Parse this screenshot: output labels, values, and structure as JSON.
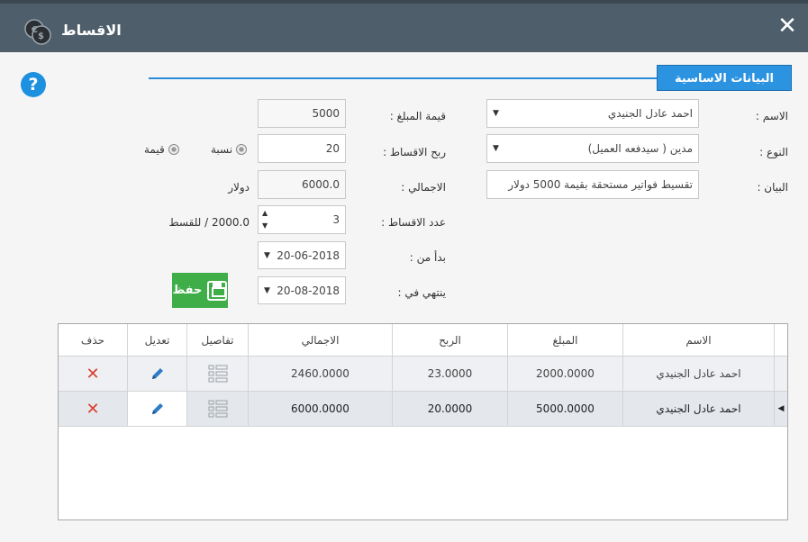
{
  "window": {
    "title": "الاقساط",
    "close_icon": "close-icon",
    "logo_icon": "coins-icon"
  },
  "help": {
    "label": "?"
  },
  "section": {
    "tab_label": "البيانات الاساسية"
  },
  "form": {
    "name": {
      "label": "الاسم :",
      "value": "احمد عادل الجنيدي"
    },
    "type": {
      "label": "النوع :",
      "value": "مدين ( سيدفعه العميل)"
    },
    "statement": {
      "label": "البيان :",
      "value": "تقسيط فواتير مستحقة بقيمة 5000 دولار"
    },
    "amount": {
      "label": "قيمة المبلغ :",
      "value": "5000"
    },
    "profit": {
      "label": "ربح الاقساط :",
      "value": "20"
    },
    "radio_percent": "نسبة",
    "radio_value": "قيمة",
    "total": {
      "label": "الاجمالي :",
      "value": "6000.0",
      "currency": "دولار"
    },
    "installments": {
      "label": "عدد الاقساط :",
      "value": "3",
      "per_installment": "2000.0 / للقسط"
    },
    "start": {
      "label": "بدأ من :",
      "value": "20-06-2018"
    },
    "end": {
      "label": "ينتهي في :",
      "value": "20-08-2018"
    },
    "save_label": "حفظ"
  },
  "grid": {
    "columns": [
      "الاسم",
      "المبلغ",
      "الربح",
      "الاجمالي",
      "تفاصيل",
      "تعديل",
      "حذف"
    ],
    "rows": [
      {
        "name": "احمد عادل الجنيدي",
        "amount": "2000.0000",
        "profit": "23.0000",
        "total": "2460.0000"
      },
      {
        "name": "احمد عادل الجنيدي",
        "amount": "5000.0000",
        "profit": "20.0000",
        "total": "6000.0000"
      }
    ],
    "delete_glyph": "✕"
  },
  "colors": {
    "titlebar": "#4e5e6b",
    "accent": "#2c93e0",
    "save": "#3fae49",
    "delete": "#d8412f"
  }
}
